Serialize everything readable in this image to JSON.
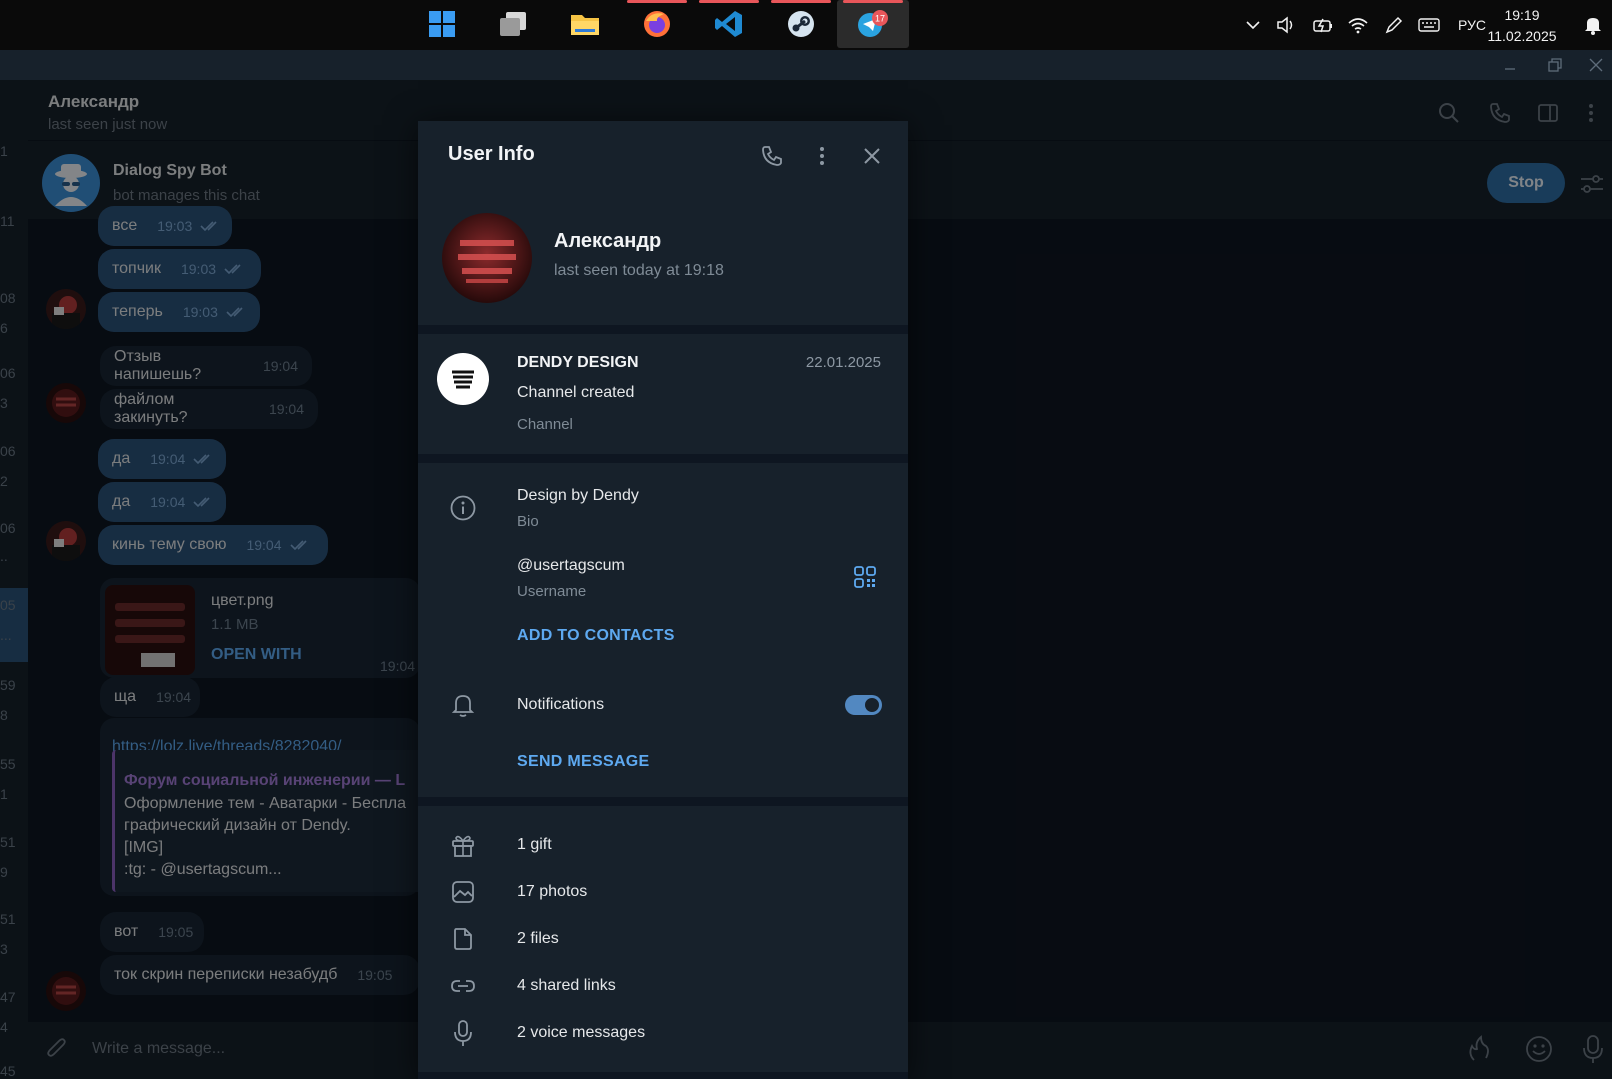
{
  "taskbar": {
    "apps": [
      {
        "name": "windows-start"
      },
      {
        "name": "task-view"
      },
      {
        "name": "file-explorer"
      },
      {
        "name": "firefox",
        "running": true
      },
      {
        "name": "vscode",
        "running": true
      },
      {
        "name": "steam",
        "running": true
      },
      {
        "name": "telegram",
        "running": true,
        "active": true,
        "badge": "17"
      }
    ],
    "tray": {
      "language": "РУС",
      "time": "19:19",
      "date": "11.02.2025"
    }
  },
  "rail": {
    "numbers": [
      "1",
      "11",
      "08",
      "6",
      "06",
      "3",
      "06",
      "2",
      "06",
      "..",
      "05",
      "...",
      "59",
      "8",
      "55",
      "1",
      "51",
      "9",
      "51",
      "3",
      "47",
      "4",
      "45"
    ]
  },
  "chat": {
    "title": "Александр",
    "status": "last seen just now",
    "pinned_bot": {
      "name": "Dialog Spy Bot",
      "subtitle": "bot manages this chat",
      "stop_label": "Stop"
    },
    "messages": [
      {
        "text": "все",
        "time": "19:03",
        "out": true
      },
      {
        "text": "топчик",
        "time": "19:03",
        "out": true
      },
      {
        "text": "теперь",
        "time": "19:03",
        "out": true
      },
      {
        "text": "Отзыв напишешь?",
        "time": "19:04",
        "out": false
      },
      {
        "text": "файлом закинуть?",
        "time": "19:04",
        "out": false
      },
      {
        "text": "да",
        "time": "19:04",
        "out": true
      },
      {
        "text": "да",
        "time": "19:04",
        "out": true
      },
      {
        "text": "кинь тему свою",
        "time": "19:04",
        "out": true
      },
      {
        "text": "ща",
        "time": "19:04",
        "out": false
      },
      {
        "text": "вот",
        "time": "19:05",
        "out": false
      },
      {
        "text": "ток скрин переписки незабудб",
        "time": "19:05",
        "out": false
      }
    ],
    "file": {
      "name": "цвет.png",
      "size": "1.1 MB",
      "action": "OPEN WITH",
      "time": "19:04"
    },
    "link": {
      "url": "https://lolz.live/threads/8282040/",
      "site": "Форум социальной инженерии — L",
      "line1": "Оформление тем - Аватарки - Беспла",
      "line2": "графический дизайн от Dendy.",
      "line3": "[IMG]",
      "line4": ":tg: - @usertagscum..."
    },
    "composer_placeholder": "Write a message..."
  },
  "user_info": {
    "title": "User Info",
    "name": "Александр",
    "last_seen": "last seen today at 19:18",
    "channel": {
      "name": "DENDY DESIGN",
      "date": "22.01.2025",
      "event": "Channel created",
      "type": "Channel"
    },
    "bio": {
      "value": "Design by Dendy",
      "label": "Bio"
    },
    "username": {
      "value": "@usertagscum",
      "label": "Username"
    },
    "add_to_contacts": "ADD TO CONTACTS",
    "notifications": {
      "label": "Notifications",
      "enabled": true
    },
    "send_message": "SEND MESSAGE",
    "media": [
      {
        "icon": "gift-icon",
        "label": "1 gift"
      },
      {
        "icon": "photo-icon",
        "label": "17 photos"
      },
      {
        "icon": "file-icon",
        "label": "2 files"
      },
      {
        "icon": "link-icon",
        "label": "4 shared links"
      },
      {
        "icon": "microphone-icon",
        "label": "2 voice messages"
      }
    ]
  },
  "colors": {
    "background": "#0e1621",
    "panel": "#17212b",
    "outgoing_bubble": "#2b5278",
    "incoming_bubble": "#182533",
    "accent": "#5ea9f0",
    "taskbar_indicator": "#e8565a"
  }
}
